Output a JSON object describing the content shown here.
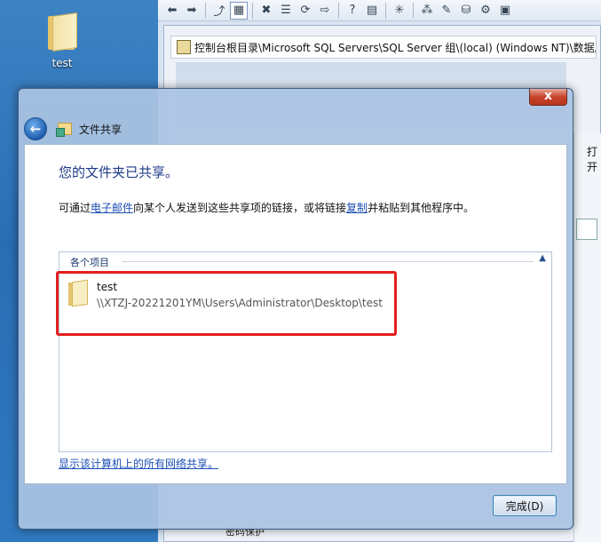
{
  "desktop": {
    "icon_label": "test"
  },
  "background_window": {
    "address": "控制台根目录\\Microsoft SQL Servers\\SQL Server 组\\(local) (Windows NT)\\数据库",
    "right_text": "打开",
    "bottom_text": "密码保护"
  },
  "dialog": {
    "close_label": "x",
    "title": "文件共享",
    "heading": "您的文件夹已共享。",
    "desc_prefix": "可通过",
    "desc_link_email": "电子邮件",
    "desc_middle": "向某个人发送到这些共享项的链接，或将链接",
    "desc_link_copy": "复制",
    "desc_suffix": "并粘贴到其他程序中。",
    "items_header": "各个项目",
    "items": [
      {
        "name": "test",
        "path": "\\\\XTZJ-20221201YM\\Users\\Administrator\\Desktop\\test"
      }
    ],
    "bottom_link": "显示该计算机上的所有网络共享。",
    "done_label": "完成(D)"
  },
  "colors": {
    "highlight": "#e32020",
    "link": "#1c4fb5",
    "heading": "#1e3a8a"
  }
}
